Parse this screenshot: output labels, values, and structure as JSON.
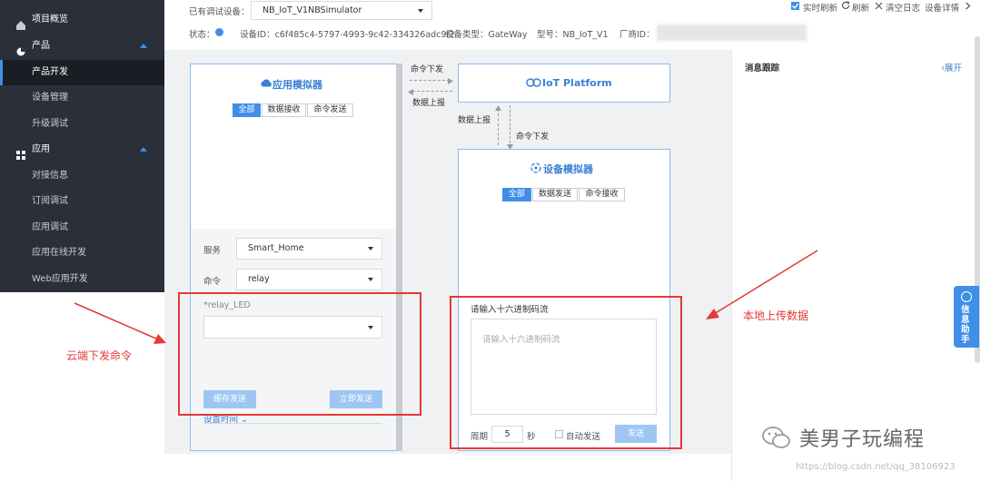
{
  "sidebar": {
    "items": [
      {
        "label": "项目概览",
        "icon": "home-icon"
      },
      {
        "label": "产品",
        "icon": "product-icon",
        "group": true
      },
      {
        "label": "产品开发",
        "active": true
      },
      {
        "label": "设备管理"
      },
      {
        "label": "升级调试"
      },
      {
        "label": "应用",
        "icon": "app-grid-icon",
        "group": true
      },
      {
        "label": "对接信息"
      },
      {
        "label": "订阅调试"
      },
      {
        "label": "应用调试"
      },
      {
        "label": "应用在线开发"
      },
      {
        "label": "Web应用开发"
      }
    ]
  },
  "header": {
    "device_select_label": "已有调试设备：",
    "device_select_value": "NB_IoT_V1NBSimulator",
    "status_label": "状态：",
    "device_id": "设备ID：c6f485c4-5797-4993-9c42-334326adc9f2",
    "device_type": "设备类型：GateWay",
    "model": "型号：NB_IoT_V1",
    "vendor_id_label": "厂商ID：",
    "realtime_refresh": "实时刷新",
    "refresh": "刷新",
    "clear_log": "清空日志",
    "device_detail": "设备详情"
  },
  "app_sim": {
    "title": "应用模拟器",
    "tabs": [
      "全部",
      "数据接收",
      "命令发送"
    ],
    "service_label": "服务",
    "service_value": "Smart_Home",
    "command_label": "命令",
    "command_value": "relay",
    "param_label": "*relay_LED",
    "save_send": "缓存发送",
    "send_now": "立即发送",
    "set_time": "设置时间"
  },
  "flow": {
    "cmd_down": "命令下发",
    "data_up": "数据上报"
  },
  "platform": {
    "title": "IoT Platform"
  },
  "device_sim": {
    "title": "设备模拟器",
    "tabs": [
      "全部",
      "数据发送",
      "命令接收"
    ],
    "hex_label": "请输入十六进制码流",
    "hex_placeholder": "请输入十六进制码流",
    "period_label": "周期",
    "period_value": "5",
    "period_unit": "秒",
    "auto_send": "自动发送",
    "send": "发送"
  },
  "trace": {
    "title": "消息跟踪",
    "expand": "展开"
  },
  "helper": {
    "label": "信息助手"
  },
  "annotations": {
    "left": "云端下发命令",
    "right": "本地上传数据",
    "color": "#e53935"
  },
  "watermark": {
    "brand": "美男子玩编程",
    "url": "https://blog.csdn.net/qq_38106923"
  },
  "colors": {
    "accent": "#3f8fe8",
    "sidebar": "#2b2f3a"
  }
}
